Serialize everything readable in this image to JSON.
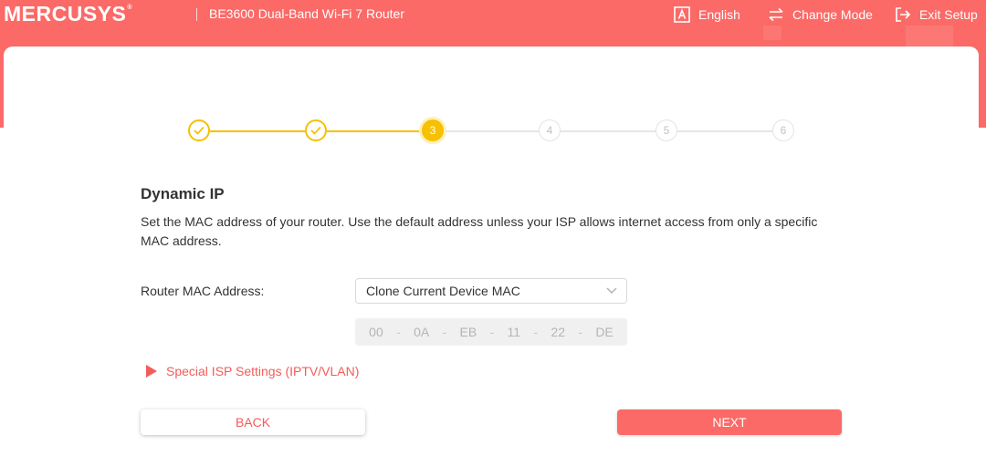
{
  "header": {
    "brand": "MERCUSYS",
    "brand_mark": "®",
    "model": "BE3600 Dual-Band Wi-Fi 7 Router",
    "language_label": "English",
    "change_mode_label": "Change Mode",
    "exit_setup_label": "Exit Setup"
  },
  "stepper": {
    "steps": [
      {
        "label": "✓",
        "state": "done"
      },
      {
        "label": "✓",
        "state": "done"
      },
      {
        "label": "3",
        "state": "active"
      },
      {
        "label": "4",
        "state": "todo"
      },
      {
        "label": "5",
        "state": "todo"
      },
      {
        "label": "6",
        "state": "todo"
      }
    ],
    "current_step": 3
  },
  "main": {
    "title": "Dynamic IP",
    "description": "Set the MAC address of your router. Use the default address unless your ISP allows internet access from only a specific MAC address.",
    "mac_field_label": "Router MAC Address:",
    "mac_select_value": "Clone Current Device MAC",
    "mac_octets": [
      "00",
      "0A",
      "EB",
      "11",
      "22",
      "DE"
    ],
    "mac_separator": "-",
    "isp_settings_link": "Special ISP Settings (IPTV/VLAN)"
  },
  "actions": {
    "back_label": "BACK",
    "next_label": "NEXT"
  },
  "colors": {
    "brand": "#fb6a67",
    "step_done": "#f7c000",
    "step_todo": "#e3e3e3",
    "link": "#f25c59"
  }
}
